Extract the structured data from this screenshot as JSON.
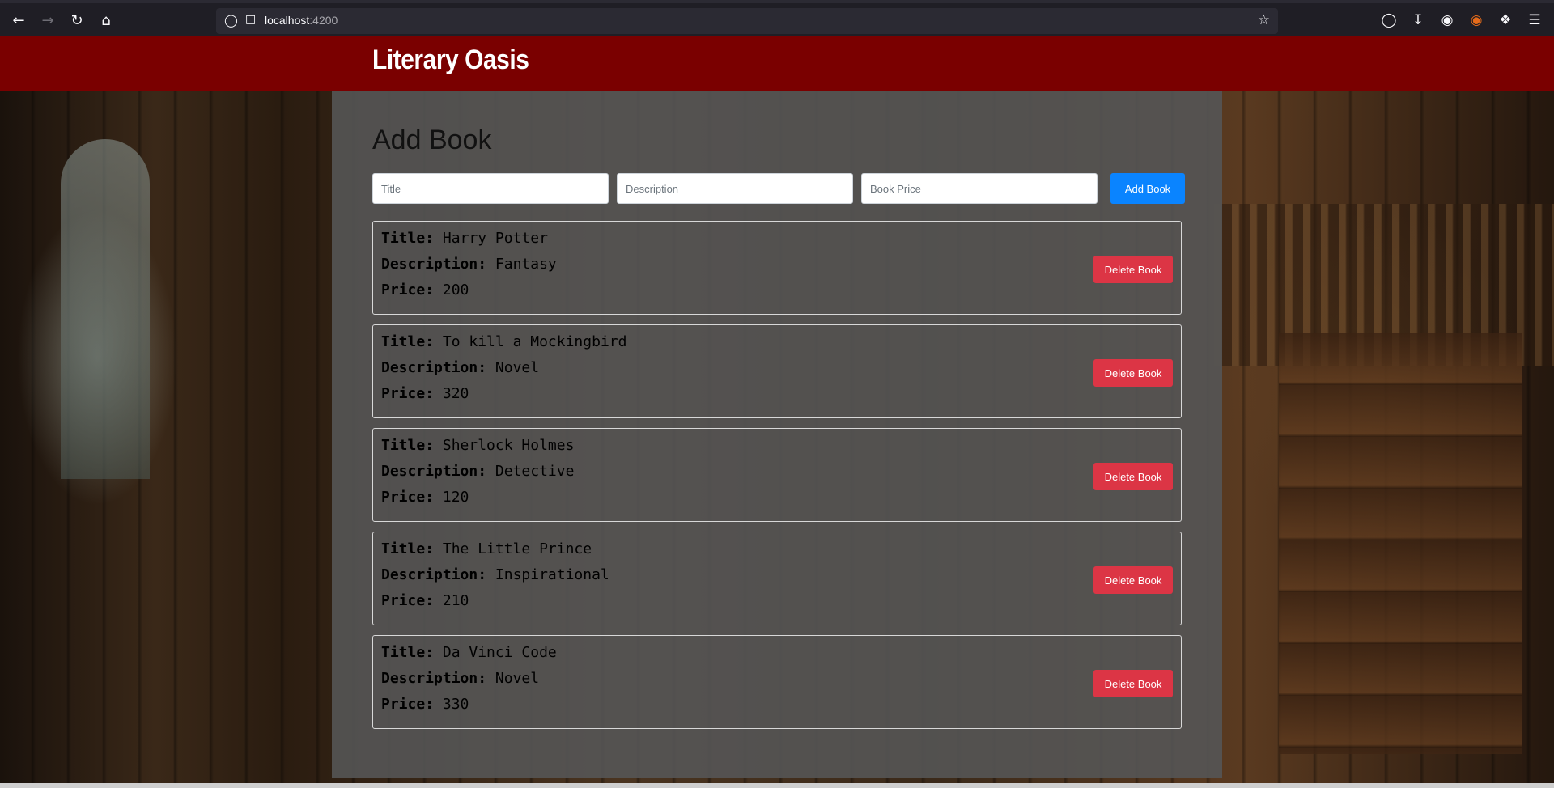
{
  "browser": {
    "url_host": "localhost",
    "url_port": ":4200"
  },
  "header": {
    "brand": "Literary Oasis"
  },
  "form": {
    "heading": "Add Book",
    "title_placeholder": "Title",
    "description_placeholder": "Description",
    "price_placeholder": "Book Price",
    "title_value": "",
    "description_value": "",
    "price_value": "",
    "add_button": "Add Book"
  },
  "labels": {
    "title": "Title:",
    "description": "Description:",
    "price": "Price:",
    "delete_button": "Delete Book"
  },
  "books": [
    {
      "title": "Harry Potter",
      "description": "Fantasy",
      "price": "200"
    },
    {
      "title": "To kill a Mockingbird",
      "description": "Novel",
      "price": "320"
    },
    {
      "title": "Sherlock Holmes",
      "description": "Detective",
      "price": "120"
    },
    {
      "title": "The Little Prince",
      "description": "Inspirational",
      "price": "210"
    },
    {
      "title": "Da Vinci Code",
      "description": "Novel",
      "price": "330"
    }
  ],
  "colors": {
    "header_bg": "#7a0000",
    "add_button": "#0a84ff",
    "delete_button": "#dc3545"
  }
}
